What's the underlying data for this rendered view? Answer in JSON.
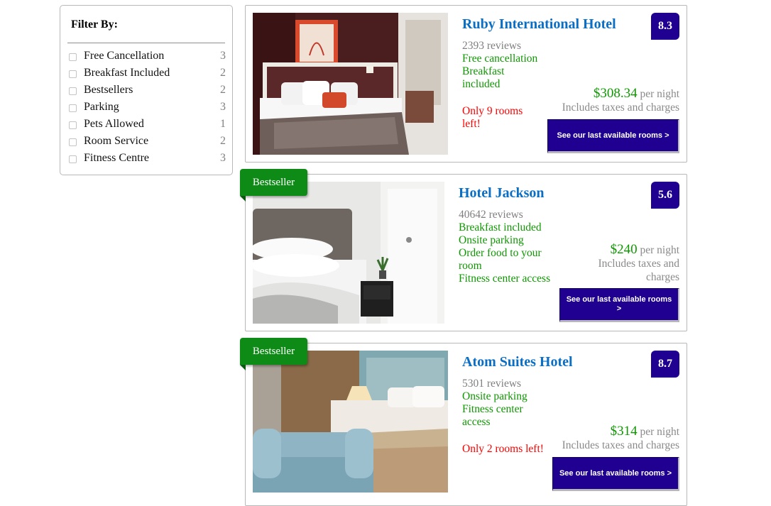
{
  "filter": {
    "title": "Filter By:",
    "options": [
      {
        "label": "Free Cancellation",
        "count": "3"
      },
      {
        "label": "Breakfast Included",
        "count": "2"
      },
      {
        "label": "Bestsellers",
        "count": "2"
      },
      {
        "label": "Parking",
        "count": "3"
      },
      {
        "label": "Pets Allowed",
        "count": "1"
      },
      {
        "label": "Room Service",
        "count": "2"
      },
      {
        "label": "Fitness Centre",
        "count": "3"
      }
    ]
  },
  "hotels": [
    {
      "name": "Ruby International Hotel",
      "reviews": "2393 reviews",
      "amenities": [
        "Free cancellation",
        "Breakfast",
        "included"
      ],
      "availability": "Only 9 rooms left!",
      "rating": "8.3",
      "price": "$308.34",
      "price_unit": "per night",
      "tax_note": "Includes taxes and charges",
      "cta": "See our last available rooms >"
    },
    {
      "badge": "Bestseller",
      "name": "Hotel Jackson",
      "reviews": "40642 reviews",
      "amenities": [
        "Breakfast included",
        "Onsite parking",
        "Order food to your room",
        "Fitness center access"
      ],
      "rating": "5.6",
      "price": "$240",
      "price_unit": "per night",
      "tax_note": "Includes taxes and charges",
      "cta": "See our last available rooms >"
    },
    {
      "badge": "Bestseller",
      "name": "Atom Suites Hotel",
      "reviews": "5301 reviews",
      "amenities": [
        "Onsite parking",
        "Fitness center",
        "access"
      ],
      "availability": "Only 2 rooms left!",
      "rating": "8.7",
      "price": "$314",
      "price_unit": "per night",
      "tax_note": "Includes taxes and charges",
      "cta": "See our last available rooms >"
    }
  ],
  "colors": {
    "accent": "#200090",
    "link": "#0a6ec5",
    "amenity": "#0e9800",
    "warning": "#ff0000",
    "bestseller": "#0e8a17"
  }
}
